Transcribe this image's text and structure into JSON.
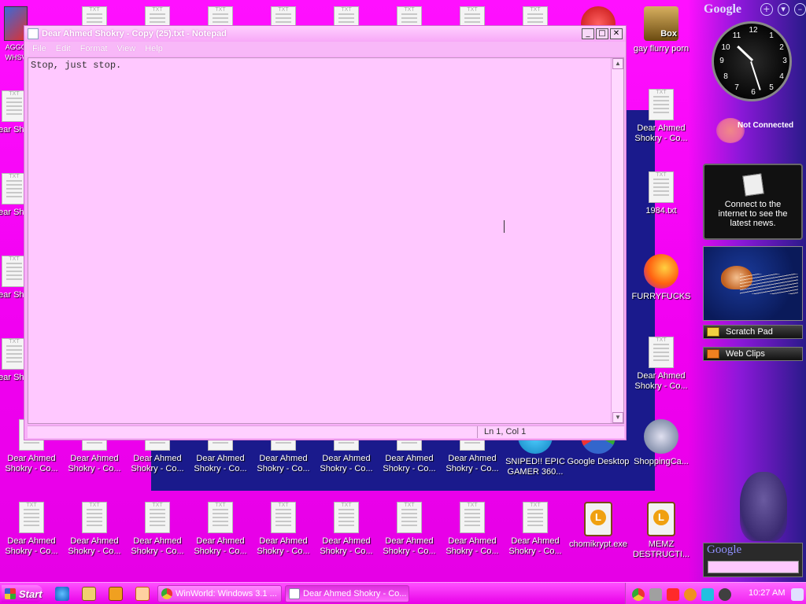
{
  "notepad": {
    "title": "Dear Ahmed Shokry - Copy (25).txt - Notepad",
    "menu": [
      "File",
      "Edit",
      "Format",
      "View",
      "Help"
    ],
    "content": "Stop, just stop.",
    "status": "Ln 1, Col 1",
    "controls": {
      "minimize": "_",
      "maximize": "□",
      "close": "✕"
    }
  },
  "desktop_icons": {
    "top_right": [
      {
        "label": "gay flurry porn",
        "icon": "box-game-icon"
      },
      {
        "label": "Dear Ahmed Shokry - Co...",
        "icon": "text-file-icon"
      },
      {
        "label": "1984.txt",
        "icon": "text-file-icon"
      },
      {
        "label": "FURRYFUCKS",
        "icon": "firefox-icon"
      },
      {
        "label": "Dear Ahmed Shokry - Co...",
        "icon": "text-file-icon"
      },
      {
        "label": "ShoppingCa...",
        "icon": "flash-icon"
      }
    ],
    "row1": [
      {
        "label": "Dear Ahmed Shokry - Co..."
      },
      {
        "label": "Dear Ahmed Shokry - Co..."
      },
      {
        "label": "Dear Ahmed Shokry - Co..."
      },
      {
        "label": "Dear Ahmed Shokry - Co..."
      },
      {
        "label": "Dear Ahmed Shokry - Co..."
      },
      {
        "label": "Dear Ahmed Shokry - Co..."
      },
      {
        "label": "Dear Ahmed Shokry - Co..."
      },
      {
        "label": "Dear Ahmed Shokry - Co..."
      },
      {
        "label": "SNIPED!! EPIC GAMER 360..."
      },
      {
        "label": "Google Desktop"
      }
    ],
    "row2": [
      {
        "label": "Dear Ahmed Shokry - Co..."
      },
      {
        "label": "Dear Ahmed Shokry - Co..."
      },
      {
        "label": "Dear Ahmed Shokry - Co..."
      },
      {
        "label": "Dear Ahmed Shokry - Co..."
      },
      {
        "label": "Dear Ahmed Shokry - Co..."
      },
      {
        "label": "Dear Ahmed Shokry - Co..."
      },
      {
        "label": "Dear Ahmed Shokry - Co..."
      },
      {
        "label": "Dear Ahmed Shokry - Co..."
      },
      {
        "label": "Dear Ahmed Shokry - Co..."
      },
      {
        "label": "chomikrypt.exe"
      },
      {
        "label": "MEMZ DESTRUCTI..."
      }
    ],
    "left_column": [
      {
        "label": "Dear Shokr"
      },
      {
        "label": "Dear Shokr"
      },
      {
        "label": "Dear Shokr"
      },
      {
        "label": "Dear Shokr"
      }
    ],
    "top_left_label": "AGGC WHSV"
  },
  "sidebar": {
    "logo": "Google",
    "header_buttons": [
      "+",
      "▾",
      "–"
    ],
    "clock_numbers": [
      "12",
      "1",
      "2",
      "3",
      "4",
      "5",
      "6",
      "7",
      "8",
      "9",
      "10",
      "11"
    ],
    "clock_time": {
      "hour": 10,
      "minute": 27
    },
    "status_text": "Not Connected",
    "news_text": "Connect to the internet to see the latest news.",
    "gadgets": [
      {
        "label": "Scratch Pad",
        "icon": "scratch-pad-icon"
      },
      {
        "label": "Web Clips",
        "icon": "rss-icon"
      }
    ],
    "search_logo": "Google"
  },
  "taskbar": {
    "start_label": "Start",
    "tasks": [
      {
        "label": "WinWorld: Windows 3.1 ...",
        "icon": "chrome-icon",
        "active": false
      },
      {
        "label": "Dear Ahmed Shokry - Co...",
        "icon": "notepad-icon",
        "active": true
      }
    ],
    "time": "10:27 AM"
  },
  "colors": {
    "wallpaper": "#ff00ff",
    "notepad_bg": "#ffc8ff",
    "taskbar": "#ee30ee"
  }
}
